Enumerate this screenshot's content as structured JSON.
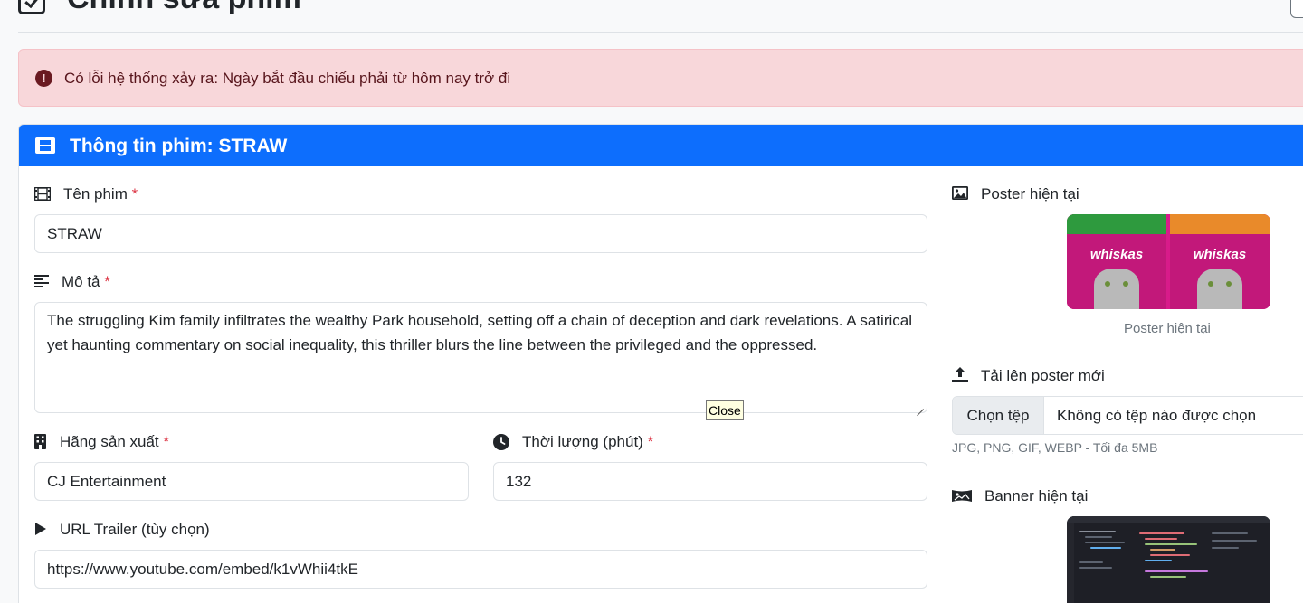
{
  "header": {
    "title": "Chỉnh sửa phim"
  },
  "alert": {
    "message": "Có lỗi hệ thống xảy ra: Ngày bắt đầu chiếu phải từ hôm nay trở đi"
  },
  "card": {
    "title": "Thông tin phim: STRAW"
  },
  "form": {
    "name": {
      "label": "Tên phim",
      "required": "*",
      "value": "STRAW"
    },
    "description": {
      "label": "Mô tả",
      "required": "*",
      "value": "The struggling Kim family infiltrates the wealthy Park household, setting off a chain of deception and dark revelations. A satirical yet haunting commentary on social inequality, this thriller blurs the line between the privileged and the oppressed."
    },
    "studio": {
      "label": "Hãng sản xuất",
      "required": "*",
      "value": "CJ Entertainment"
    },
    "duration": {
      "label": "Thời lượng (phút)",
      "required": "*",
      "value": "132"
    },
    "trailer": {
      "label": "URL Trailer (tùy chọn)",
      "value": "https://www.youtube.com/embed/k1vWhii4tkE"
    }
  },
  "tooltip": {
    "text": "Close"
  },
  "poster": {
    "label": "Poster hiện tại",
    "caption": "Poster hiện tại",
    "image_brand_text": "whiskas"
  },
  "upload": {
    "label": "Tải lên poster mới",
    "button": "Chọn tệp",
    "status": "Không có tệp nào được chọn",
    "hint": "JPG, PNG, GIF, WEBP - Tối đa 5MB"
  },
  "banner": {
    "label": "Banner hiện tại"
  },
  "colors": {
    "primary": "#0d6efd",
    "danger": "#dc3545",
    "alert_bg": "#f8d7da",
    "alert_text": "#58151c"
  }
}
